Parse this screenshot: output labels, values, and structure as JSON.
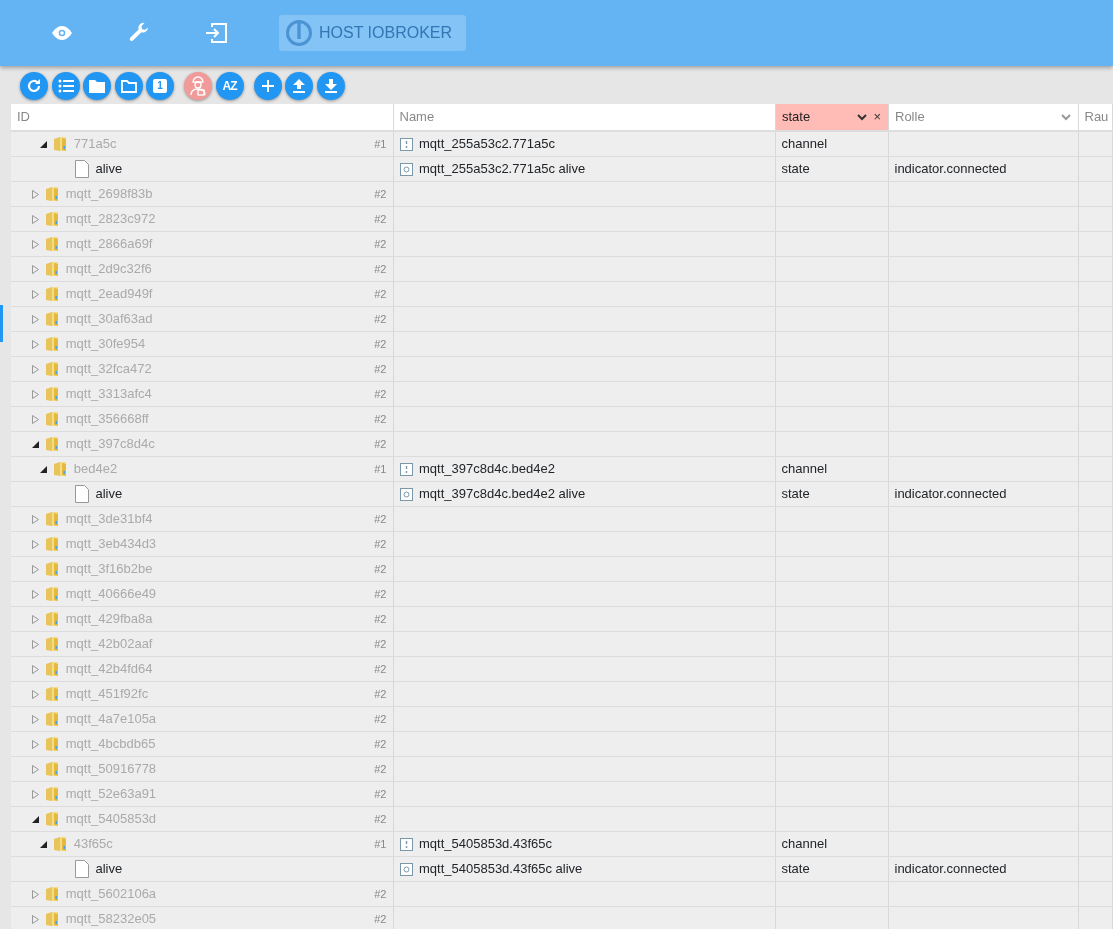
{
  "nav": {
    "items": [
      {
        "kind": "eye"
      },
      {
        "kind": "wrench"
      },
      {
        "kind": "login"
      }
    ],
    "host_button": {
      "label": "HOST IOBROKER",
      "disabled": true
    }
  },
  "toolbar": [
    {
      "buttons": [
        {
          "kind": "refresh",
          "selected": false
        },
        {
          "kind": "list",
          "selected": false
        },
        {
          "kind": "folder",
          "selected": false
        },
        {
          "kind": "folder-outline",
          "selected": false
        },
        {
          "kind": "number",
          "label": "1",
          "selected": false
        }
      ]
    },
    {
      "buttons": [
        {
          "kind": "expert",
          "selected": true
        },
        {
          "kind": "sort",
          "label": "AZ",
          "selected": false
        }
      ]
    },
    {
      "buttons": [
        {
          "kind": "add",
          "selected": false
        },
        {
          "kind": "upload",
          "selected": false
        },
        {
          "kind": "download",
          "selected": false
        }
      ]
    }
  ],
  "columns": [
    {
      "kind": "text",
      "placeholder": "ID"
    },
    {
      "kind": "text",
      "placeholder": "Name"
    },
    {
      "kind": "select",
      "value": "state",
      "clear": "×"
    },
    {
      "kind": "select",
      "placeholder": "Rolle"
    },
    {
      "kind": "text",
      "placeholder": "Rau"
    }
  ],
  "tree": [
    {
      "children": [
        {
          "label": "771a5c",
          "kind": "folder",
          "expanded": true,
          "count": "#1",
          "name": {
            "text": "mqtt_255a53c2.771a5c",
            "kind": "channel"
          },
          "type": "channel",
          "children": [
            {
              "label": "alive",
              "kind": "file",
              "name": {
                "text": "mqtt_255a53c2.771a5c alive",
                "kind": "state"
              },
              "type": "state",
              "role": "indicator.connected"
            }
          ]
        }
      ]
    },
    {
      "label": "mqtt_2698f83b",
      "kind": "folder",
      "expanded": false,
      "count": "#2"
    },
    {
      "label": "mqtt_2823c972",
      "kind": "folder",
      "expanded": false,
      "count": "#2"
    },
    {
      "label": "mqtt_2866a69f",
      "kind": "folder",
      "expanded": false,
      "count": "#2"
    },
    {
      "label": "mqtt_2d9c32f6",
      "kind": "folder",
      "expanded": false,
      "count": "#2"
    },
    {
      "label": "mqtt_2ead949f",
      "kind": "folder",
      "expanded": false,
      "count": "#2"
    },
    {
      "label": "mqtt_30af63ad",
      "kind": "folder",
      "expanded": false,
      "count": "#2"
    },
    {
      "label": "mqtt_30fe954",
      "kind": "folder",
      "expanded": false,
      "count": "#2"
    },
    {
      "label": "mqtt_32fca472",
      "kind": "folder",
      "expanded": false,
      "count": "#2"
    },
    {
      "label": "mqtt_3313afc4",
      "kind": "folder",
      "expanded": false,
      "count": "#2"
    },
    {
      "label": "mqtt_356668ff",
      "kind": "folder",
      "expanded": false,
      "count": "#2"
    },
    {
      "label": "mqtt_397c8d4c",
      "kind": "folder",
      "expanded": true,
      "count": "#2",
      "children": [
        {
          "label": "bed4e2",
          "kind": "folder",
          "expanded": true,
          "count": "#1",
          "name": {
            "text": "mqtt_397c8d4c.bed4e2",
            "kind": "channel"
          },
          "type": "channel",
          "children": [
            {
              "label": "alive",
              "kind": "file",
              "name": {
                "text": "mqtt_397c8d4c.bed4e2 alive",
                "kind": "state"
              },
              "type": "state",
              "role": "indicator.connected"
            }
          ]
        }
      ]
    },
    {
      "label": "mqtt_3de31bf4",
      "kind": "folder",
      "expanded": false,
      "count": "#2"
    },
    {
      "label": "mqtt_3eb434d3",
      "kind": "folder",
      "expanded": false,
      "count": "#2"
    },
    {
      "label": "mqtt_3f16b2be",
      "kind": "folder",
      "expanded": false,
      "count": "#2"
    },
    {
      "label": "mqtt_40666e49",
      "kind": "folder",
      "expanded": false,
      "count": "#2"
    },
    {
      "label": "mqtt_429fba8a",
      "kind": "folder",
      "expanded": false,
      "count": "#2"
    },
    {
      "label": "mqtt_42b02aaf",
      "kind": "folder",
      "expanded": false,
      "count": "#2"
    },
    {
      "label": "mqtt_42b4fd64",
      "kind": "folder",
      "expanded": false,
      "count": "#2"
    },
    {
      "label": "mqtt_451f92fc",
      "kind": "folder",
      "expanded": false,
      "count": "#2"
    },
    {
      "label": "mqtt_4a7e105a",
      "kind": "folder",
      "expanded": false,
      "count": "#2"
    },
    {
      "label": "mqtt_4bcbdb65",
      "kind": "folder",
      "expanded": false,
      "count": "#2"
    },
    {
      "label": "mqtt_50916778",
      "kind": "folder",
      "expanded": false,
      "count": "#2"
    },
    {
      "label": "mqtt_52e63a91",
      "kind": "folder",
      "expanded": false,
      "count": "#2"
    },
    {
      "label": "mqtt_5405853d",
      "kind": "folder",
      "expanded": true,
      "count": "#2",
      "children": [
        {
          "label": "43f65c",
          "kind": "folder",
          "expanded": true,
          "count": "#1",
          "name": {
            "text": "mqtt_5405853d.43f65c",
            "kind": "channel"
          },
          "type": "channel",
          "children": [
            {
              "label": "alive",
              "kind": "file",
              "name": {
                "text": "mqtt_5405853d.43f65c alive",
                "kind": "state"
              },
              "type": "state",
              "role": "indicator.connected"
            }
          ]
        }
      ]
    },
    {
      "label": "mqtt_5602106a",
      "kind": "folder",
      "expanded": false,
      "count": "#2"
    },
    {
      "label": "mqtt_58232e05",
      "kind": "folder",
      "expanded": false,
      "count": "#2"
    }
  ]
}
